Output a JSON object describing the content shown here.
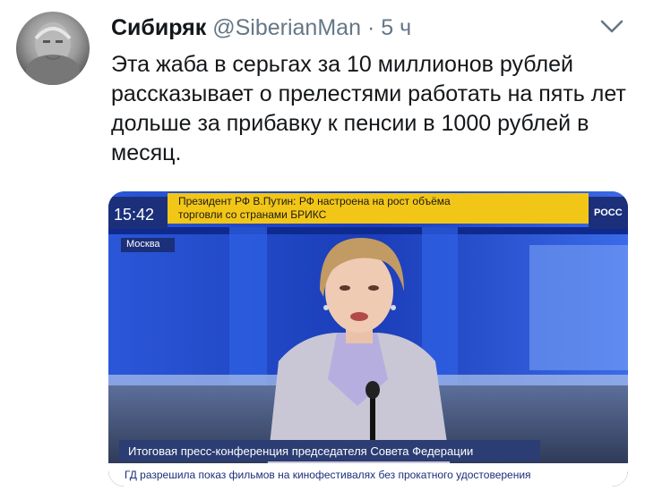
{
  "tweet": {
    "author_name": "Сибиряк",
    "author_handle": "@SiberianMan",
    "separator": "·",
    "time": "5 ч",
    "text": "Эта жаба в серьгах за 10 миллионов рублей рассказывает о прелестями работать на пять лет дольше за прибавку к пенсии в 1000 рублей в месяц."
  },
  "media": {
    "clock": "15:42",
    "headline_line1": "Президент РФ В.Путин: РФ настроена на рост объёма",
    "headline_line2": "торговли со странами БРИКС",
    "channel": "РОСС",
    "city": "Москва",
    "caption": "Итоговая пресс-конференция председателя Совета Федерации",
    "ticker": "ГД разрешила показ фильмов на кинофестивалях без прокатного удостоверения"
  },
  "icons": {
    "avatar": "avatar",
    "menu": "chevron-down-icon"
  }
}
